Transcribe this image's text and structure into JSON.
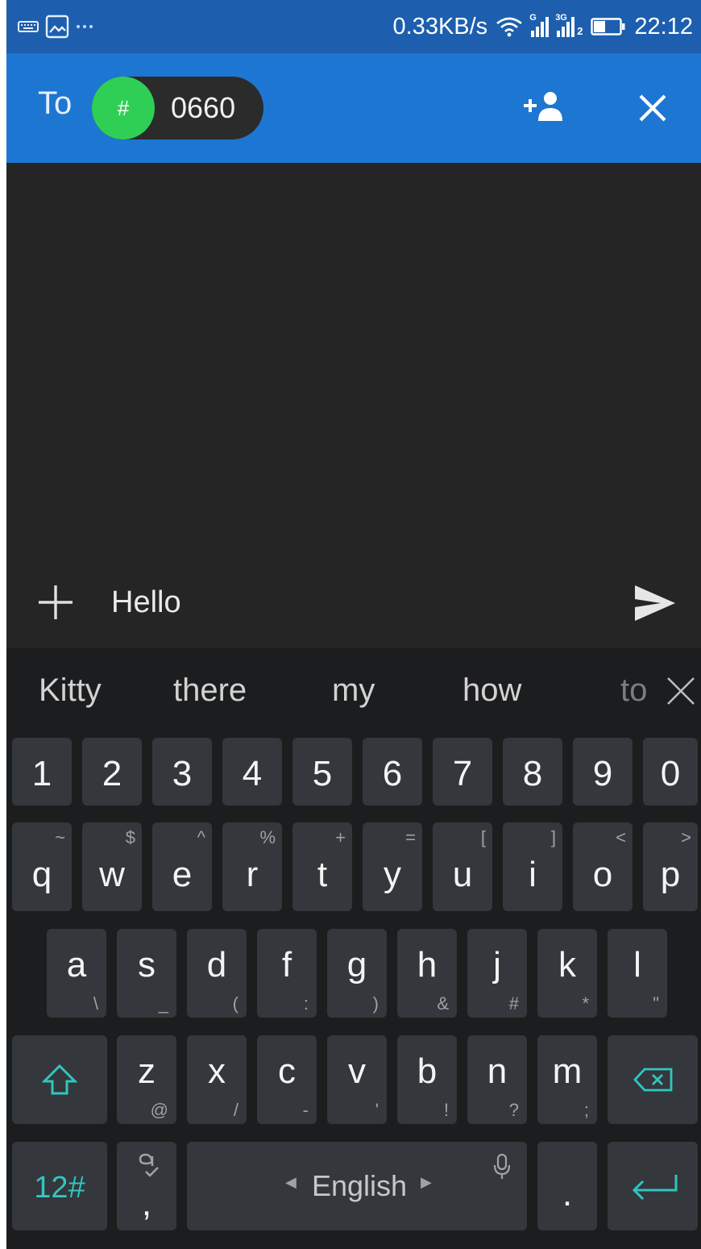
{
  "status_bar": {
    "network_speed": "0.33KB/s",
    "sim1_tag": "G",
    "sim2_tag": "3G",
    "sim2_index": "2",
    "time": "22:12",
    "left_icons": [
      "keyboard-icon",
      "image-icon",
      "more-dots-icon"
    ]
  },
  "header": {
    "to_label": "To",
    "recipient_avatar": "#",
    "recipient_number": "0660",
    "actions": [
      "add-contact-icon",
      "close-icon"
    ]
  },
  "compose": {
    "message_text": "Hello",
    "attach_icon": "plus-icon",
    "send_icon": "send-icon"
  },
  "keyboard": {
    "suggestions": [
      "Kitty",
      "there",
      "my",
      "how",
      "to"
    ],
    "number_row": [
      "1",
      "2",
      "3",
      "4",
      "5",
      "6",
      "7",
      "8",
      "9",
      "0"
    ],
    "row1": [
      {
        "key": "q",
        "alt": "~"
      },
      {
        "key": "w",
        "alt": "$"
      },
      {
        "key": "e",
        "alt": "^"
      },
      {
        "key": "r",
        "alt": "%"
      },
      {
        "key": "t",
        "alt": "+"
      },
      {
        "key": "y",
        "alt": "="
      },
      {
        "key": "u",
        "alt": "["
      },
      {
        "key": "i",
        "alt": "]"
      },
      {
        "key": "o",
        "alt": "<"
      },
      {
        "key": "p",
        "alt": ">"
      }
    ],
    "row2": [
      {
        "key": "a",
        "alt": "\\"
      },
      {
        "key": "s",
        "alt": "_"
      },
      {
        "key": "d",
        "alt": "("
      },
      {
        "key": "f",
        "alt": ":"
      },
      {
        "key": "g",
        "alt": ")"
      },
      {
        "key": "h",
        "alt": "&"
      },
      {
        "key": "j",
        "alt": "#"
      },
      {
        "key": "k",
        "alt": "*"
      },
      {
        "key": "l",
        "alt": "\""
      }
    ],
    "row3": [
      {
        "key": "z",
        "alt": "@"
      },
      {
        "key": "x",
        "alt": "/"
      },
      {
        "key": "c",
        "alt": "-"
      },
      {
        "key": "v",
        "alt": "'"
      },
      {
        "key": "b",
        "alt": "!"
      },
      {
        "key": "n",
        "alt": "?"
      },
      {
        "key": "m",
        "alt": ";"
      }
    ],
    "symbols_key": "12#",
    "comma_key": ",",
    "period_key": ".",
    "language": "English",
    "accent_color": "#30c6c0"
  }
}
